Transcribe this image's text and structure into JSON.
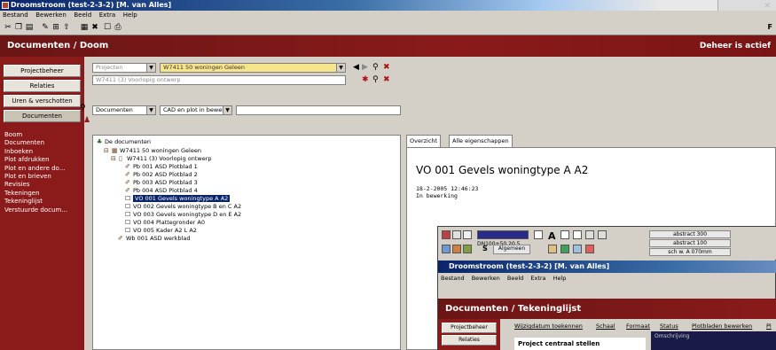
{
  "window": {
    "title": "Droomstroom (test-2-3-2) [M. van Alles]"
  },
  "menu": [
    "Bestand",
    "Bewerken",
    "Beeld",
    "Extra",
    "Help"
  ],
  "toolbar": {
    "right_label": "F"
  },
  "header": {
    "title": "Documenten / Doom",
    "status": "Deheer is actief"
  },
  "sidebar": {
    "buttons": [
      "Projectbeheer",
      "Relaties",
      "Uren & verschotten",
      "Documenten"
    ],
    "items": [
      "Boom",
      "Documenten",
      "Inboeken",
      "Plot afdrukken",
      "Plot en andere do...",
      "Plot en brieven",
      "Revisies",
      "Tekeningen",
      "Tekeninglijst",
      "Verstuurde docum..."
    ]
  },
  "filters": {
    "project_type": "Projecten",
    "project_value": "W7411 50 woningen Geleen",
    "phase_value": "W7411 (3) Voorlopig ontwerp",
    "doc_type": "Documenten",
    "doc_filter": "CAD en plot in bewerk",
    "search_value": ""
  },
  "tree": {
    "root": "De documenten",
    "project": "W7411 50 woningen Geleen",
    "phase": "W7411 (3) Voorlopig ontwerp",
    "items": [
      "Pb 001 ASD Plotblad 1",
      "Pb 002 ASD Plotblad 2",
      "Pb 003 ASD Plotblad 3",
      "Pb 004 ASD Plotblad 4",
      "VO 001 Gevels woningtype A A2",
      "VO 002 Gevels woningtype B en C A2",
      "VO 003 Gevels woningtype D en E A2",
      "VO 004 Plattegronder A0",
      "VO 005 Kader A2 L A2",
      "Wb 001 ASD werkblad"
    ],
    "selected_index": 4
  },
  "details": {
    "tabs": [
      "Overzicht",
      "Alle eigenschappen"
    ],
    "heading": "VO 001 Gevels woningtype A A2",
    "date": "18-2-2005 12:46:23",
    "status": "In bewerking"
  },
  "overlay": {
    "title": "Droomstroom (test-2-3-2) [M. van Alles]",
    "menu": [
      "Bestand",
      "Bewerken",
      "Beeld",
      "Extra",
      "Help"
    ],
    "header": "Documenten / Tekeninglijst",
    "sidebar_buttons": [
      "Projectbeheer",
      "Relaties"
    ],
    "columns": [
      "Wijzigdatum toekennen",
      "Schaal",
      "Formaat",
      "Status",
      "Plotbladen bewerken",
      "Pl"
    ],
    "project_button": "Project centraal stellen",
    "dark_label": "Omschrijving",
    "toolbar_labels": [
      "abstract 300",
      "abstract 100",
      "sch w. A 070mm"
    ],
    "scale_label": "DN100+50 20 5",
    "s_label": "S",
    "algemeen": "Algemeen",
    "a_label": "A"
  }
}
